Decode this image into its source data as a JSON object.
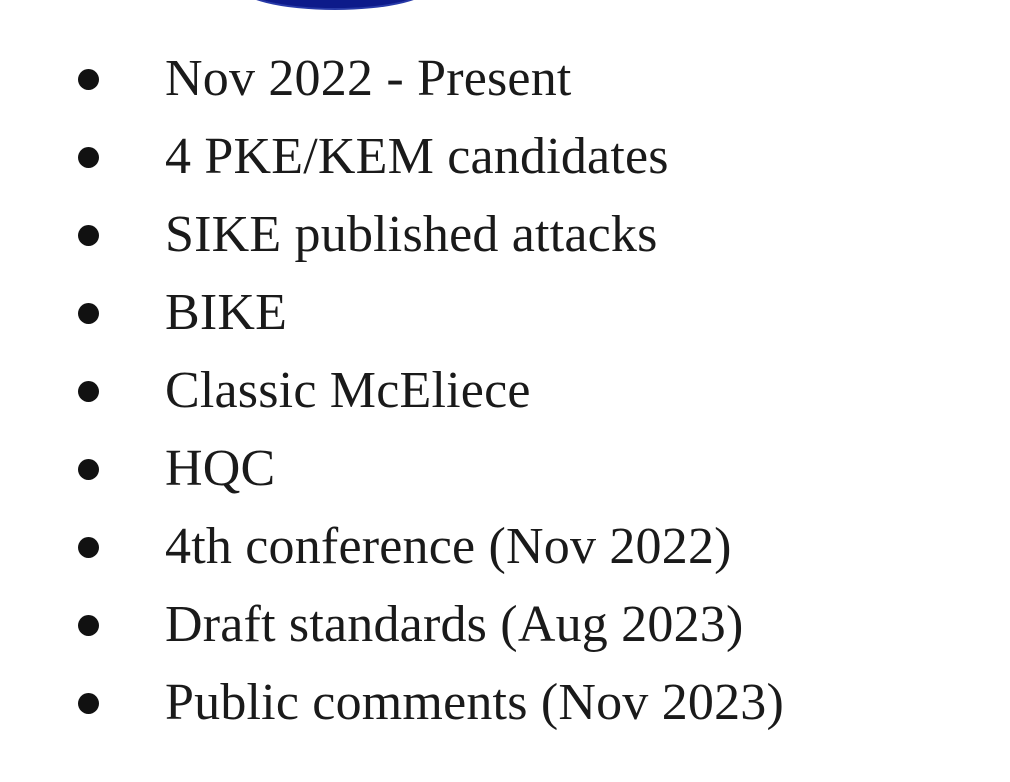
{
  "bullets": [
    "Nov 2022 - Present",
    "4 PKE/KEM candidates",
    "SIKE published attacks",
    "BIKE",
    "Classic McEliece",
    "HQC",
    "4th conference (Nov 2022)",
    "Draft standards (Aug 2023)",
    "Public comments (Nov 2023)"
  ]
}
